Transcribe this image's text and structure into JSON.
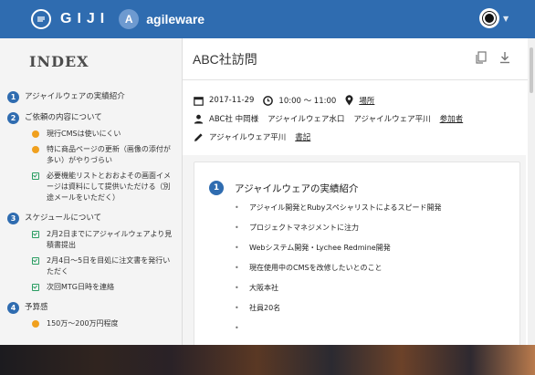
{
  "app": {
    "brand": "GIJI",
    "workspace_initial": "A",
    "workspace_name": "agileware"
  },
  "sidebar": {
    "title": "INDEX",
    "sections": [
      {
        "num": "1",
        "label": "アジャイルウェアの実績紹介",
        "items": []
      },
      {
        "num": "2",
        "label": "ご依頼の内容について",
        "items": [
          {
            "type": "warn",
            "text": "現行CMSは使いにくい"
          },
          {
            "type": "warn",
            "text": "特に商品ページの更新（画像の添付が多い）がやりづらい"
          },
          {
            "type": "check",
            "text": "必要機能リストとおおよその画面イメージは資料にして提供いただける（別途メールをいただく）"
          }
        ]
      },
      {
        "num": "3",
        "label": "スケジュールについて",
        "items": [
          {
            "type": "check",
            "text": "2月2日までにアジャイルウェアより見積書提出"
          },
          {
            "type": "check",
            "text": "2月4日〜5日を目処に注文書を発行いただく"
          },
          {
            "type": "check",
            "text": "次回MTG日時を連絡"
          }
        ]
      },
      {
        "num": "4",
        "label": "予算感",
        "items": [
          {
            "type": "warn",
            "text": "150万〜200万円程度"
          }
        ]
      }
    ]
  },
  "main": {
    "title": "ABC社訪問",
    "date": "2017-11-29",
    "time": "10:00 〜 11:00",
    "place_link": "場所",
    "participants": [
      "ABC社 中岡様",
      "アジャイルウェア水口",
      "アジャイルウェア平川"
    ],
    "participants_link": "参加者",
    "writer": "アジャイルウェア平川",
    "writer_link": "書記"
  },
  "card": {
    "num": "1",
    "title": "アジャイルウェアの実績紹介",
    "bullets": [
      "アジャイル開発とRubyスペシャリストによるスピード開発",
      "プロジェクトマネジメントに注力",
      "Webシステム開発・Lychee Redmine開発",
      "現在使用中のCMSを改修したいとのこと",
      "大阪本社",
      "社員20名",
      ""
    ]
  },
  "icons": {
    "brand": "giji-logo-icon",
    "calendar": "calendar-icon",
    "clock": "clock-icon",
    "location": "location-pin-icon",
    "participants": "person-icon",
    "writer": "pencil-icon",
    "copy": "copy-icon",
    "download": "download-icon"
  },
  "colors": {
    "primary": "#2f6cb0",
    "warn": "#f0a01e",
    "check": "#2a9d62"
  }
}
